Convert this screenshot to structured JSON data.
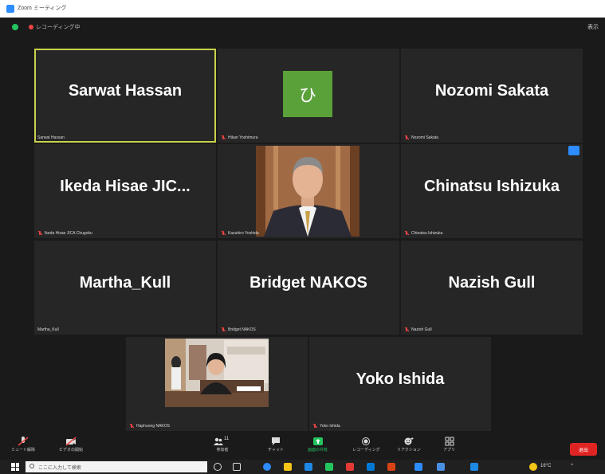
{
  "window": {
    "title": "Zoom ミーティング"
  },
  "top_bar": {
    "recording_label": "レコーディング中",
    "view_label": "表示"
  },
  "participants": [
    {
      "display_name": "Sarwat Hassan",
      "label": "Sarwat Hassan",
      "muted": false,
      "active_speaker": true
    },
    {
      "display_name": "ひ",
      "label": "Hikari Yoshimura",
      "muted": true,
      "avatar_color": "#5aa13a"
    },
    {
      "display_name": "Nozomi Sakata",
      "label": "Nozomi Sakata",
      "muted": true
    },
    {
      "display_name": "Ikeda Hisae JIC...",
      "label": "Ikeda Hisae JICA Chugoku",
      "muted": true
    },
    {
      "display_name": "",
      "label": "Kazuhiro Yoshida",
      "muted": true,
      "video": true
    },
    {
      "display_name": "Chinatsu Ishizuka",
      "label": "Chinatsu Ishizuka",
      "muted": true
    },
    {
      "display_name": "Martha_Kull",
      "label": "Martha_Kull",
      "muted": false
    },
    {
      "display_name": "Bridget NAKOS",
      "label": "Bridget NAKOS",
      "muted": true
    },
    {
      "display_name": "Nazish Gull",
      "label": "Nazish Gull",
      "muted": true
    },
    {
      "display_name": "",
      "label": "Haphuong NAKOS",
      "muted": true,
      "video": true
    },
    {
      "display_name": "Yoko Ishida",
      "label": "Yoko Ishida",
      "muted": true
    }
  ],
  "toolbar": {
    "mute_label": "ミュート解除",
    "video_label": "ビデオの開始",
    "participants_label": "参加者",
    "participants_count": "11",
    "chat_label": "チャット",
    "share_label": "画面の共有",
    "record_label": "レコーディング",
    "reactions_label": "リアクション",
    "apps_label": "アプリ",
    "end_label": "退出",
    "accent_color": "#22c55e",
    "end_color": "#e02424"
  },
  "taskbar": {
    "search_placeholder": "ここに入力して検索",
    "temperature": "16°C"
  }
}
